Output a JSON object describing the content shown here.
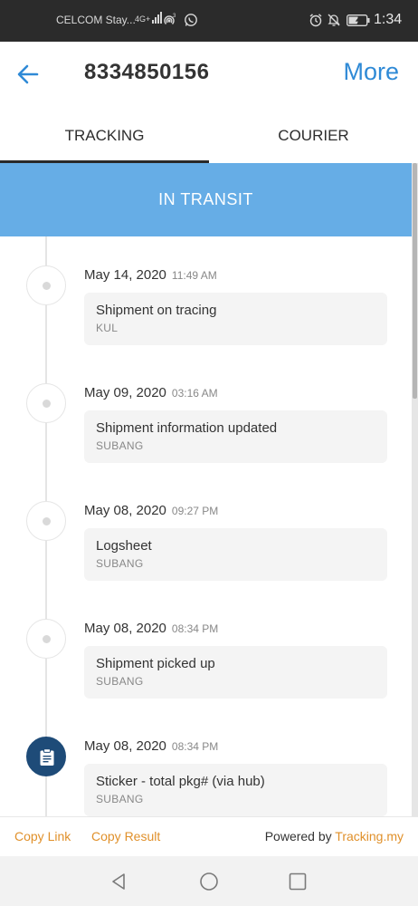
{
  "status_bar": {
    "carrier": "CELCOM Stay...",
    "network": "4G+",
    "hotspot_badge": "3",
    "time": "1:34"
  },
  "app_bar": {
    "title": "8334850156",
    "more_label": "More"
  },
  "tabs": [
    {
      "label": "TRACKING",
      "active": true
    },
    {
      "label": "COURIER",
      "active": false
    }
  ],
  "status_banner": "IN TRANSIT",
  "events": [
    {
      "date": "May 14, 2020",
      "time": "11:49 AM",
      "description": "Shipment on tracing",
      "location": "KUL",
      "icon": "dot-icon"
    },
    {
      "date": "May 09, 2020",
      "time": "03:16 AM",
      "description": "Shipment information updated",
      "location": "SUBANG",
      "icon": "dot-icon"
    },
    {
      "date": "May 08, 2020",
      "time": "09:27 PM",
      "description": "Logsheet",
      "location": "SUBANG",
      "icon": "dot-icon"
    },
    {
      "date": "May 08, 2020",
      "time": "08:34 PM",
      "description": "Shipment picked up",
      "location": "SUBANG",
      "icon": "dot-icon"
    },
    {
      "date": "May 08, 2020",
      "time": "08:34 PM",
      "description": "Sticker - total pkg# (via hub)",
      "location": "SUBANG",
      "icon": "clipboard-icon"
    }
  ],
  "footer": {
    "copy_link": "Copy Link",
    "copy_result": "Copy Result",
    "powered_by": "Powered by",
    "brand": "Tracking.my"
  },
  "colors": {
    "accent": "#2f8ad6",
    "banner": "#66ade6",
    "footer_link": "#e0902a",
    "current_node": "#1e4b78"
  }
}
